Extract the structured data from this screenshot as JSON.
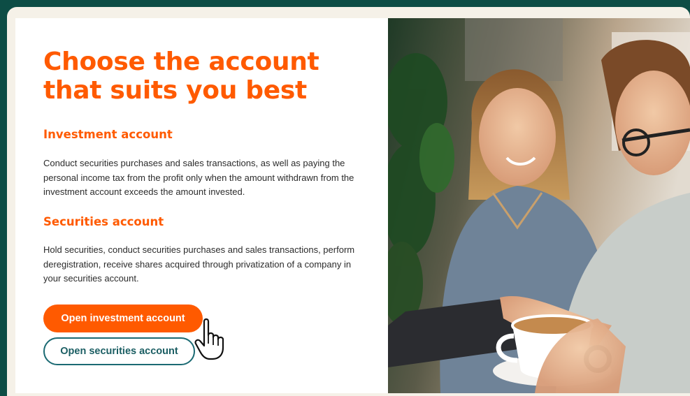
{
  "title": "Choose the account that suits you best",
  "sections": [
    {
      "heading": "Investment account",
      "text": "Conduct securities purchases and sales transactions, as well as paying the personal income tax from the profit only when the amount withdrawn from the investment account exceeds the amount invested."
    },
    {
      "heading": "Securities account",
      "text": "Hold securities, conduct securities purchases and sales transactions, perform deregistration, receive shares acquired through privatization of a company in your securities account."
    }
  ],
  "buttons": {
    "primary_label": "Open investment account",
    "secondary_label": "Open securities account"
  },
  "colors": {
    "accent": "#ff5a00",
    "secondary": "#1b6a73",
    "page_background": "#0d4d45",
    "frame_background": "#f5f1e8"
  },
  "icons": {
    "cursor": "hand-pointer-icon"
  },
  "photo": {
    "subject": "photo-two-people-laptop-coffee"
  }
}
